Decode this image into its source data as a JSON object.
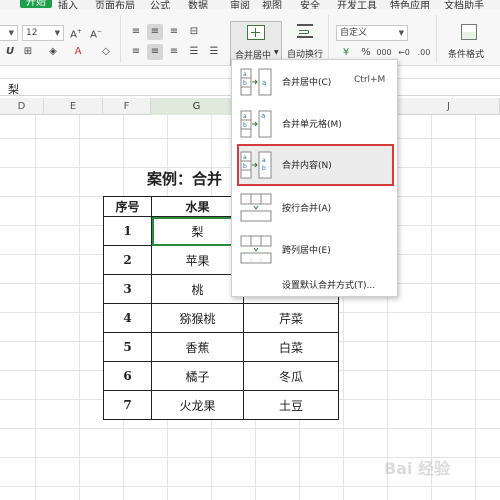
{
  "menu_tabs": [
    {
      "label": "开始",
      "active": true
    },
    {
      "label": "插入"
    },
    {
      "label": "页面布局"
    },
    {
      "label": "公式"
    },
    {
      "label": "数据"
    },
    {
      "label": "审阅"
    },
    {
      "label": "视图"
    },
    {
      "label": "安全"
    },
    {
      "label": "开发工具"
    },
    {
      "label": "特色应用"
    },
    {
      "label": "文档助手"
    }
  ],
  "ribbon": {
    "font_size": "12",
    "merge_center_label": "合并居中",
    "wrap_text_label": "自动换行",
    "number_format": "自定义",
    "conditional_format_label": "条件格式"
  },
  "formula_bar": {
    "content": "梨"
  },
  "columns": [
    "D",
    "E",
    "F",
    "G",
    "H",
    "I",
    "J"
  ],
  "sheet": {
    "title": "案例：合并",
    "headers": [
      "序号",
      "水果",
      ""
    ],
    "rows": [
      {
        "seq": "1",
        "fruit": "梨",
        "veg": ""
      },
      {
        "seq": "2",
        "fruit": "苹果",
        "veg": ""
      },
      {
        "seq": "3",
        "fruit": "桃",
        "veg": ""
      },
      {
        "seq": "4",
        "fruit": "猕猴桃",
        "veg": "芹菜"
      },
      {
        "seq": "5",
        "fruit": "香蕉",
        "veg": "白菜"
      },
      {
        "seq": "6",
        "fruit": "橘子",
        "veg": "冬瓜"
      },
      {
        "seq": "7",
        "fruit": "火龙果",
        "veg": "土豆"
      }
    ]
  },
  "merge_dropdown": {
    "items": [
      {
        "label": "合并居中(C)",
        "shortcut": "Ctrl+M",
        "icon": "merge-center-icon"
      },
      {
        "label": "合并单元格(M)",
        "icon": "merge-cells-icon"
      },
      {
        "label": "合并内容(N)",
        "icon": "merge-content-icon",
        "highlighted": true
      },
      {
        "label": "按行合并(A)",
        "icon": "merge-across-icon"
      },
      {
        "label": "跨列居中(E)",
        "icon": "center-across-icon"
      }
    ],
    "footer": "设置默认合并方式(T)...",
    "highlight_color": "#d43b3b"
  },
  "watermark": "Bai 经验",
  "colors": {
    "accent_green": "#1e9e4a",
    "highlight_red": "#d43b3b"
  }
}
